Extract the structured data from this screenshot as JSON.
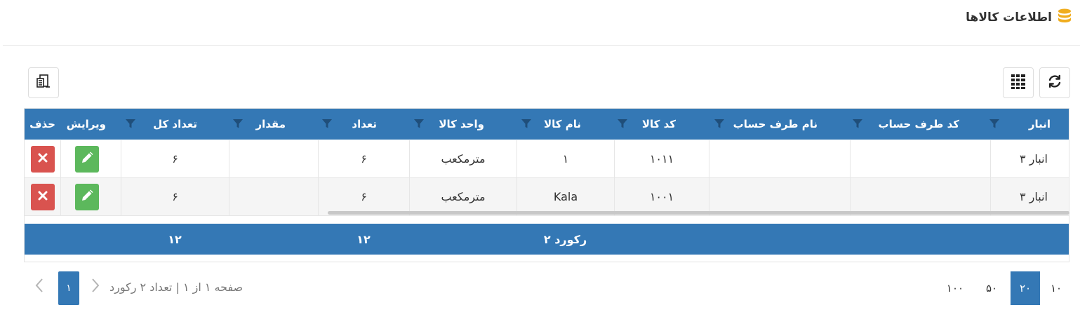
{
  "panel": {
    "title": "اطلاعات کالاها",
    "icon": "database-icon"
  },
  "toolbar": {
    "refresh_icon": "refresh-icon",
    "columns_icon": "grid-icon",
    "export_icon": "export-icon"
  },
  "table": {
    "columns": [
      "انبار",
      "کد طرف حساب",
      "نام طرف حساب",
      "کد کالا",
      "نام کالا",
      "واحد کالا",
      "تعداد",
      "مقدار",
      "تعداد کل",
      "ویرایش",
      "حذف"
    ],
    "rows": [
      {
        "warehouse": "انبار ۳",
        "account_code": "",
        "account_name": "",
        "item_code": "۱۰۱۱",
        "item_name": "۱",
        "unit": "مترمکعب",
        "count": "۶",
        "amount": "",
        "total": "۶"
      },
      {
        "warehouse": "انبار ۳",
        "account_code": "",
        "account_name": "",
        "item_code": "۱۰۰۱",
        "item_name": "Kala",
        "unit": "مترمکعب",
        "count": "۶",
        "amount": "",
        "total": "۶"
      }
    ],
    "footer": {
      "records": "۲ رکورد",
      "count_sum": "۱۲",
      "total_sum": "۱۲"
    }
  },
  "pager": {
    "sizes": [
      "۱۰",
      "۲۰",
      "۵۰",
      "۱۰۰"
    ],
    "selected_size": "۲۰",
    "info": "صفحه ۱ از ۱ | تعداد ۲ رکورد",
    "current_page": "۱"
  },
  "colors": {
    "header": "#3478b5",
    "delete": "#d9534f",
    "edit": "#5cb85c"
  }
}
